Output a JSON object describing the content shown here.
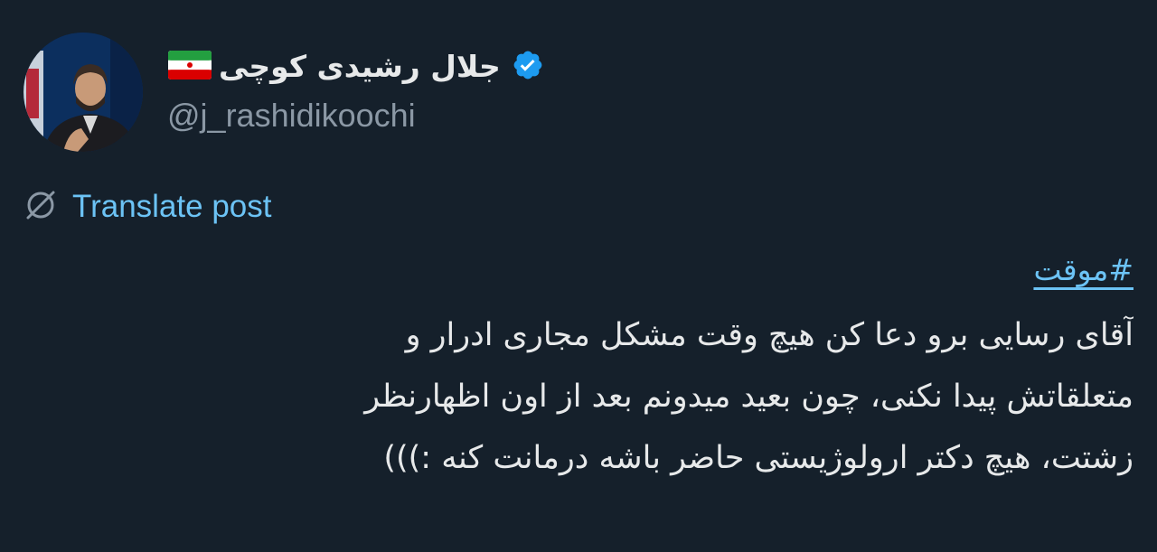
{
  "author": {
    "display_name": "جلال رشیدی کوچی",
    "handle": "@j_rashidikoochi",
    "verified": true,
    "flag_icon": "iran-flag-icon",
    "avatar": "author-avatar-photo"
  },
  "translate": {
    "icon": "globe-slash-icon",
    "label": "Translate post"
  },
  "post": {
    "hashtag": "#موقت",
    "lines": [
      "آقای رسایی برو دعا کن هیچ وقت مشکل مجاری ادرار و",
      "متعلقاتش پیدا نکنی، چون بعید میدونم بعد از اون اظهارنظر",
      "زشتت، هیچ دکتر ارولوژیستی حاضر باشه درمانت کنه :)))"
    ]
  },
  "colors": {
    "background": "#15202b",
    "text": "#e7e9ea",
    "secondary_text": "#8b98a5",
    "link": "#6cc3f5",
    "verified_badge": "#1d9bf0"
  }
}
